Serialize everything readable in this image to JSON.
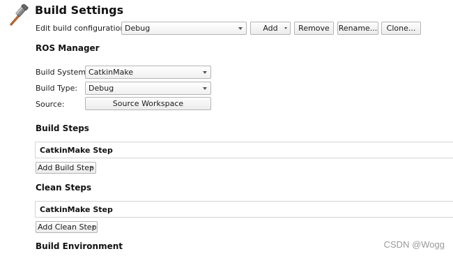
{
  "header": {
    "title": "Build Settings",
    "icon": "hammer-icon"
  },
  "config_row": {
    "label": "Edit build configuration:",
    "selected": "Debug",
    "add": "Add",
    "remove": "Remove",
    "rename": "Rename...",
    "clone": "Clone..."
  },
  "ros_manager": {
    "title": "ROS Manager",
    "build_system_label": "Build System:",
    "build_system_value": "CatkinMake",
    "build_type_label": "Build Type:",
    "build_type_value": "Debug",
    "source_label": "Source:",
    "source_button": "Source Workspace"
  },
  "build_steps": {
    "title": "Build Steps",
    "step": "CatkinMake Step",
    "add_button": "Add Build Step"
  },
  "clean_steps": {
    "title": "Clean Steps",
    "step": "CatkinMake Step",
    "add_button": "Add Clean Step"
  },
  "build_environment": {
    "title": "Build Environment"
  },
  "watermark": "CSDN @Wogg"
}
